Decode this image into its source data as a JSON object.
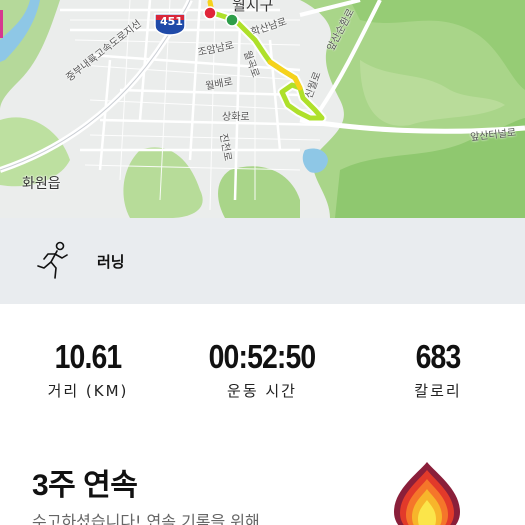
{
  "map": {
    "labels": {
      "district_top": "월지구",
      "hakson": "학산남로",
      "joam": "조암남로",
      "gyeongbu": "중부내륙고속도로지선",
      "wolbae": "월배로",
      "apsan_sunhwan": "앞산순환로",
      "sinwol": "신월로",
      "sanghwa": "상화로",
      "jinchun": "진천로",
      "hwawon": "화원읍",
      "apsan_teo": "앞산터널로",
      "wolgok": "월곡로"
    },
    "route_shield": "451",
    "colors": {
      "route_fast": "#aee02a",
      "route_slow": "#f6d21b",
      "start": "#e0263a",
      "end": "#2e9e4a"
    }
  },
  "activity": {
    "type_label": "러닝",
    "icon": "running-person-icon"
  },
  "stats": {
    "distance": {
      "value": "10.61",
      "label": "거리 (KM)"
    },
    "duration": {
      "value": "00:52:50",
      "label": "운동 시간"
    },
    "calories": {
      "value": "683",
      "label": "칼로리"
    }
  },
  "streak": {
    "title": "3주 연속",
    "description": "수고하셨습니다! 연속 기록을 위해",
    "icon": "flame-icon",
    "flame_colors": [
      "#8a1f3a",
      "#e23a2a",
      "#f5762a",
      "#f7b52b",
      "#fbe54a"
    ]
  }
}
